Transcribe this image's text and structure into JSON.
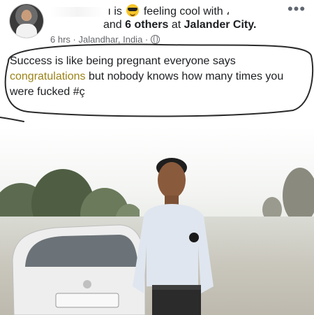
{
  "post": {
    "author_line_prefix": "ı is",
    "status_text": "feeling cool with",
    "status_trailing": "،",
    "tag_line_middle": "and",
    "others_count_text": "6 others",
    "at_text": "at",
    "place": "Jalander City.",
    "time": "6 hrs",
    "location": "Jalandhar, India",
    "separator": "·",
    "more_label": "•••",
    "emoji": "sunglasses-emoji"
  },
  "caption": {
    "part1": "Success is like being pregnant everyone says",
    "highlight": "congratulations",
    "part2": "but nobody knows how many times you were fucked #ç"
  },
  "colors": {
    "text": "#1c1e21",
    "meta": "#65676b",
    "highlight": "#9a8318",
    "circle_ink": "#2a2a2a"
  }
}
